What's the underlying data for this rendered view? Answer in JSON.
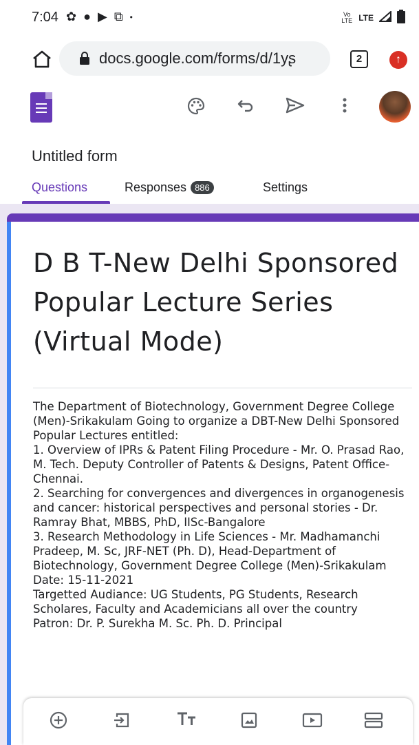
{
  "status_bar": {
    "time": "7:04",
    "network_small": "Vo LTE",
    "network": "LTE"
  },
  "browser": {
    "url": "docs.google.com/forms/d/1yʂ",
    "tab_count": "2"
  },
  "forms": {
    "form_title": "Untitled form",
    "tabs": [
      {
        "label": "Questions"
      },
      {
        "label": "Responses",
        "badge": "886"
      },
      {
        "label": "Settings"
      }
    ]
  },
  "card": {
    "title": "D B T-New Delhi Sponsored Popular Lecture Series (Virtual Mode)",
    "description": "The Department of Biotechnology, Government Degree College (Men)-Srikakulam Going to organize a DBT-New Delhi Sponsored Popular Lectures entitled:\n1. Overview of IPRs & Patent Filing Procedure - Mr. O. Prasad Rao, M. Tech. Deputy Controller of Patents & Designs, Patent Office-Chennai.\n2. Searching for convergences and divergences in organogenesis and cancer: historical perspectives and personal stories - Dr. Ramray Bhat, MBBS, PhD, IISc-Bangalore\n3. Research Methodology in Life Sciences - Mr. Madhamanchi Pradeep, M. Sc, JRF-NET (Ph. D), Head-Department of Biotechnology, Government Degree College (Men)-Srikakulam\nDate: 15-11-2021\nTargetted Audiance: UG Students, PG Students, Research Scholares, Faculty and Academicians all over the country\nPatron: Dr. P. Surekha M. Sc. Ph. D. Principal"
  },
  "colors": {
    "accent": "#673ab7",
    "left_bar": "#4285f4",
    "background": "#ebe6f3"
  },
  "icons": {
    "toolbar": [
      "palette-icon",
      "undo-icon",
      "send-icon",
      "more-vert-icon"
    ],
    "bottom": [
      "add-question-icon",
      "import-questions-icon",
      "add-title-icon",
      "add-image-icon",
      "add-video-icon",
      "add-section-icon"
    ]
  }
}
